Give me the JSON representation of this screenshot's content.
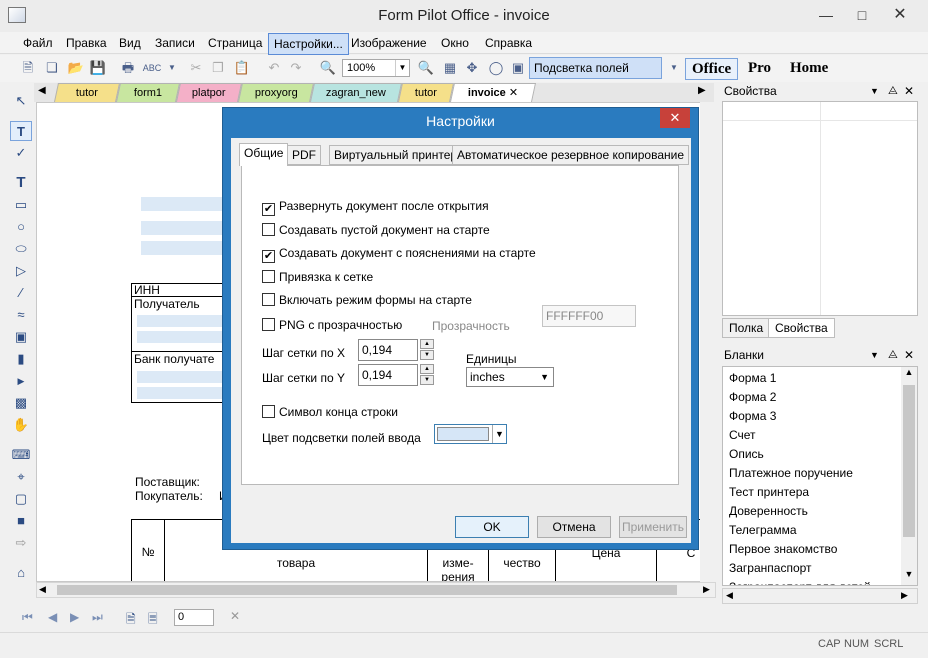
{
  "window": {
    "title": "Form Pilot Office - invoice",
    "min_icon": "minimize-icon",
    "max_icon": "maximize-icon",
    "close_icon": "close-icon"
  },
  "menu": [
    "Файл",
    "Правка",
    "Вид",
    "Записи",
    "Страница",
    "Настройки...",
    "Изображение",
    "Окно",
    "Справка"
  ],
  "toolbar": {
    "zoom": "100%",
    "highlight_button": "Подсветка полей ввода",
    "editions": [
      "Office",
      "Pro",
      "Home"
    ]
  },
  "doc_tabs": [
    {
      "label": "tutor",
      "color": "#f5e08a"
    },
    {
      "label": "form1",
      "color": "#c8e6a0"
    },
    {
      "label": "platpor",
      "color": "#f4b0c8"
    },
    {
      "label": "proxyorg",
      "color": "#c8e6a0"
    },
    {
      "label": "zagran_new",
      "color": "#b8e4e0"
    },
    {
      "label": "tutor",
      "color": "#f5e08a"
    },
    {
      "label": "invoice",
      "color": "#f8e0f0",
      "close": "✕"
    }
  ],
  "canvas": {
    "inn": "ИНН",
    "recipient": "Получатель",
    "bank": "Банк получате",
    "supplier": "Поставщик:",
    "buyer": "Покупатель:",
    "buyer_cut": "И",
    "table": {
      "num": "№",
      "goods": "товара",
      "unit": "изме-\nрения",
      "qty": "чество",
      "price": "Цена",
      "cut": "С"
    }
  },
  "dialog": {
    "title": "Настройки",
    "tabs": [
      "Общие",
      "PDF",
      "Виртуальный принтер",
      "Автоматическое резервное копирование"
    ],
    "checkboxes": [
      {
        "label": "Развернуть документ после открытия",
        "checked": true
      },
      {
        "label": "Создавать пустой документ на старте",
        "checked": false
      },
      {
        "label": "Создавать документ с пояснениями на старте",
        "checked": true
      },
      {
        "label": "Привязка к сетке",
        "checked": false
      },
      {
        "label": "Включать режим формы на старте",
        "checked": false
      },
      {
        "label": "PNG с прозрачностью",
        "checked": false
      },
      {
        "label": "Символ конца строки",
        "checked": false
      }
    ],
    "transparency_label": "Прозрачность",
    "transparency_value": "FFFFFF00",
    "grid_x_label": "Шаг сетки по X",
    "grid_x_value": "0,194",
    "grid_y_label": "Шаг сетки по Y",
    "grid_y_value": "0,194",
    "units_label": "Единицы",
    "units_value": "inches",
    "highlight_color_label": "Цвет подсветки полей ввода",
    "highlight_color": "#d6e6f7",
    "ok": "OK",
    "cancel": "Отмена",
    "apply": "Применить"
  },
  "properties_panel": {
    "title": "Свойства",
    "tabs": [
      "Полка",
      "Свойства"
    ]
  },
  "blanks_panel": {
    "title": "Бланки",
    "items": [
      "Форма 1",
      "Форма 2",
      "Форма 3",
      "Счет",
      "Опись",
      "Платежное поручение",
      "Тест принтера",
      "Доверенность",
      "Телеграмма",
      "Первое знакомство",
      "Загранпаспорт",
      "Загранпаспорт для детей"
    ]
  },
  "nav": {
    "page": "0"
  },
  "status": [
    "CAP",
    "NUM",
    "SCRL"
  ]
}
